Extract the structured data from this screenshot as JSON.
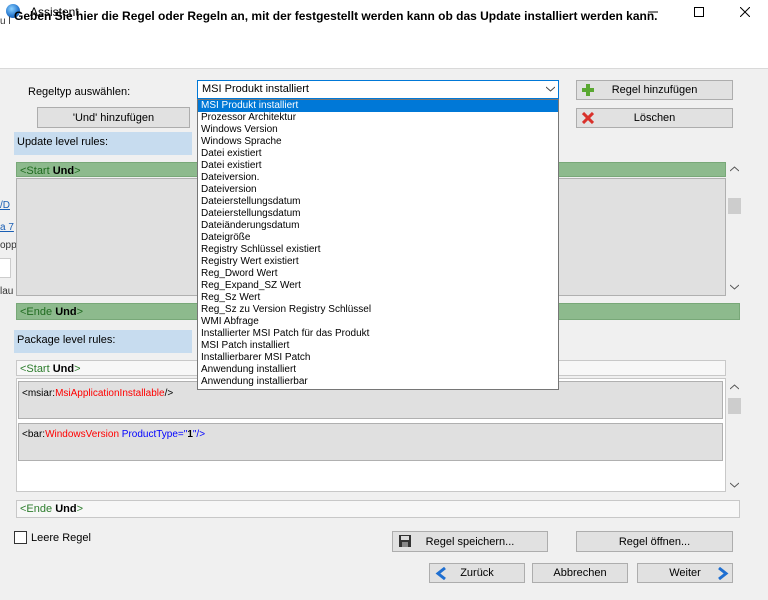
{
  "window": {
    "title": "Assistent",
    "heading": "Geben Sie hier die Regel oder Regeln an, mit der festgestellt werden kann ob das Update installiert werden kann."
  },
  "left_slivers": [
    "u l",
    "/D",
    "a 7",
    "opp",
    "lau"
  ],
  "rule_type": {
    "label": "Regeltyp auswählen:",
    "selected": "MSI Produkt installiert",
    "options": [
      "MSI Produkt installiert",
      "Prozessor Architektur",
      "Windows Version",
      "Windows Sprache",
      "Datei existiert",
      "Datei existiert",
      "Dateiversion.",
      "Dateiversion",
      "Dateierstellungsdatum",
      "Dateierstellungsdatum",
      "Dateiänderungsdatum",
      "Dateigröße",
      "Registry Schlüssel existiert",
      "Registry Wert existiert",
      "Reg_Dword Wert",
      "Reg_Expand_SZ Wert",
      "Reg_Sz Wert",
      "Reg_Sz zu Version Registry Schlüssel",
      "WMI Abfrage",
      "Installierter MSI Patch für das Produkt",
      "MSI Patch installiert",
      "Installierbarer MSI Patch",
      "Anwendung installiert",
      "Anwendung installierbar"
    ]
  },
  "buttons": {
    "add_and": "'Und' hinzufügen",
    "add_rule": "Regel hinzufügen",
    "delete": "Löschen",
    "save_rule": "Regel speichern...",
    "open_rule": "Regel öffnen...",
    "back": "Zurück",
    "cancel": "Abbrechen",
    "next": "Weiter"
  },
  "update_rules": {
    "label": "Update level rules:",
    "start_tag": "<Start",
    "start_kw": "Und",
    "end_tag": "<Ende",
    "end_kw": "Und",
    "close": ">"
  },
  "package_rules": {
    "label": "Package level rules:",
    "start_tag": "<Start",
    "start_kw": "Und",
    "end_tag": "<Ende",
    "end_kw": "Und",
    "close": ">",
    "rule1": {
      "open": "<msiar:",
      "name": "MsiApplicationInstallable",
      "close": "/>"
    },
    "rule2": {
      "open": "<bar:",
      "name": "WindowsVersion",
      "attr": " ProductType=\"",
      "value": "1",
      "close": "\"/>"
    }
  },
  "checkbox": {
    "label": "Leere Regel",
    "checked": false
  },
  "colors": {
    "accent": "#0078d7",
    "green_bar": "#8dba8d",
    "label_bg": "#c7dcef"
  }
}
